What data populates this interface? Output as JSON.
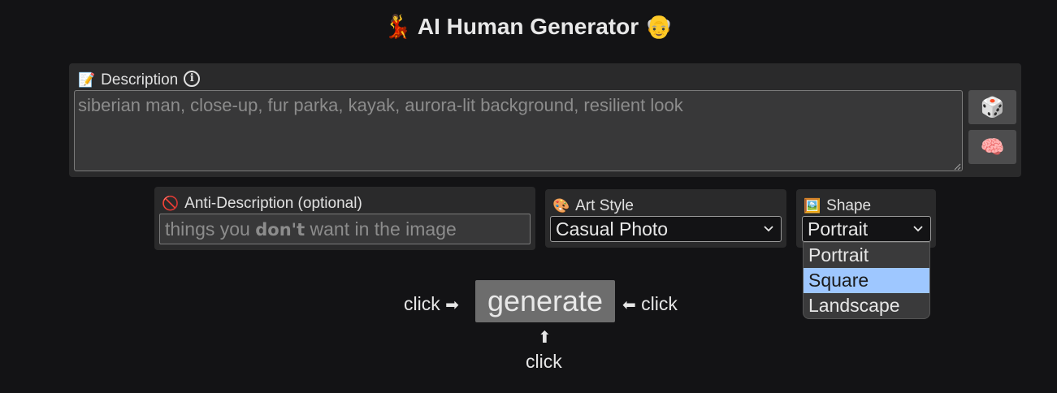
{
  "title": {
    "left_emoji": "💃",
    "text": "AI Human Generator",
    "right_emoji": "👴"
  },
  "description": {
    "label_emoji": "📝",
    "label": "Description",
    "info_icon": "ⓘ",
    "placeholder": "siberian man, close-up, fur parka, kayak, aurora-lit background, resilient look",
    "value": "",
    "random_button_icon": "🎲",
    "brain_button_icon": "🧠"
  },
  "anti_description": {
    "label_emoji": "🚫",
    "label": "Anti-Description (optional)",
    "placeholder_before": "things you ",
    "placeholder_bold": "don't",
    "placeholder_after": " want in the image"
  },
  "art_style": {
    "label_emoji": "🎨",
    "label": "Art Style",
    "selected": "Casual Photo"
  },
  "shape": {
    "label_emoji": "🖼️",
    "label": "Shape",
    "selected": "Portrait",
    "options": [
      "Portrait",
      "Square",
      "Landscape"
    ],
    "highlighted_option": "Square"
  },
  "generate": {
    "button_label": "generate",
    "left_hint": "click",
    "right_hint": "click",
    "bottom_hint": "click",
    "left_arrow": "➡",
    "right_arrow": "⬅",
    "up_arrow": "⬆"
  },
  "colors": {
    "background": "#131315",
    "panel": "#2a2a2b",
    "input": "#383839",
    "highlight": "#9ec7ff",
    "button": "#6d6d6d"
  }
}
